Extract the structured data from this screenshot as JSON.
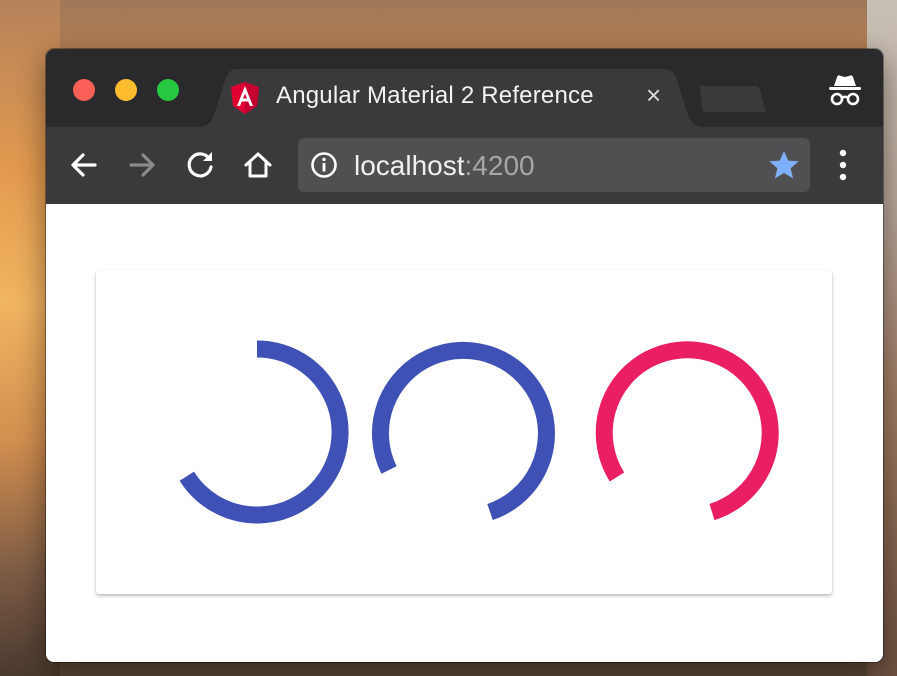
{
  "browser": {
    "tab": {
      "title": "Angular Material 2 Reference",
      "close_glyph": "×",
      "favicon": "angular-logo-icon"
    },
    "toolbar": {
      "back_icon": "back-arrow-icon",
      "forward_icon": "forward-arrow-icon",
      "reload_icon": "reload-icon",
      "home_icon": "home-icon",
      "menu_icon": "more-vertical-icon"
    },
    "omnibox": {
      "host": "localhost",
      "port": ":4200",
      "info_icon": "info-icon",
      "bookmark_icon": "star-icon"
    },
    "incognito_icon": "incognito-icon"
  },
  "page": {
    "spinners": [
      {
        "kind": "progress-spinner",
        "color": "#3f51b5",
        "arc_degrees": 226
      },
      {
        "kind": "progress-spinner",
        "color": "#3f51b5",
        "arc_degrees": 250
      },
      {
        "kind": "progress-spinner",
        "color": "#e91e63",
        "arc_degrees": 235
      }
    ]
  },
  "colors": {
    "primary": "#3f51b5",
    "accent": "#e91e63",
    "bookmark_star": "#7fb0ff"
  }
}
